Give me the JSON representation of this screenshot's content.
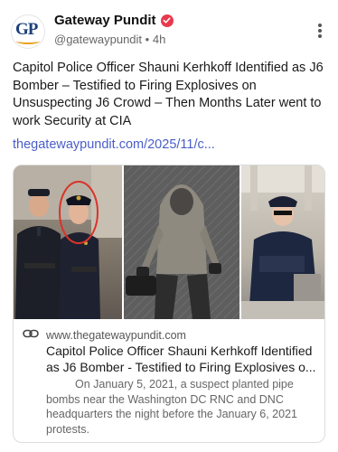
{
  "account": {
    "avatar_text": "GP",
    "display_name": "Gateway Pundit",
    "handle": "@gatewaypundit",
    "separator": "•",
    "age": "4h"
  },
  "post": {
    "text": "Capitol Police Officer Shauni Kerhkoff Identified as J6 Bomber – Testified to Firing Explosives on Unsuspecting J6 Crowd – Then Months Later went to work Security at CIA",
    "link": "thegatewaypundit.com/2025/11/c..."
  },
  "card": {
    "domain": "www.thegatewaypundit.com",
    "title": "Capitol Police Officer Shauni Kerhkoff Identified as J6 Bomber - Testified to Firing Explosives o...",
    "description": "On January 5, 2021, a suspect planted pipe bombs near the Washington DC RNC and DNC headquarters the night before the January 6, 2021 protests."
  },
  "colors": {
    "verified_badge": "#e8394d",
    "link": "#4a5ec8",
    "brand_navy": "#1d3f7a",
    "brand_gold": "#e8a21c",
    "highlight_circle": "#d9332b"
  },
  "icons": [
    "verified-check-icon",
    "more-options-icon",
    "link-icon"
  ]
}
